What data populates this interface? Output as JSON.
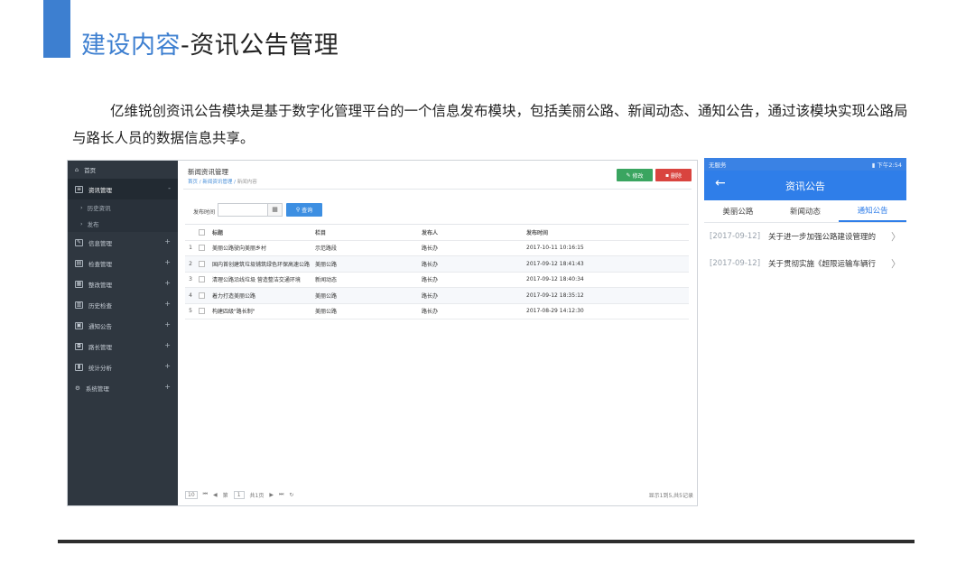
{
  "slide": {
    "title_accent": "建设内容",
    "title_rest": "-资讯公告管理",
    "description": "亿维锐创资讯公告模块是基于数字化管理平台的一个信息发布模块，包括美丽公路、新闻动态、通知公告，通过该模块实现公路局与路长人员的数据信息共享。"
  },
  "admin": {
    "sidebar": {
      "home": "首页",
      "items": [
        {
          "label": "资讯管理",
          "toggle": "-"
        },
        {
          "label": "信息管理",
          "toggle": "+"
        },
        {
          "label": "检查管理",
          "toggle": "+"
        },
        {
          "label": "整改管理",
          "toggle": "+"
        },
        {
          "label": "历史检查",
          "toggle": "+"
        },
        {
          "label": "通知公告",
          "toggle": "+"
        },
        {
          "label": "路长管理",
          "toggle": "+"
        },
        {
          "label": "统计分析",
          "toggle": "+"
        },
        {
          "label": "系统管理",
          "toggle": "+"
        }
      ],
      "subitems": [
        "历史资讯",
        "发布"
      ]
    },
    "page_title": "新闻资讯管理",
    "breadcrumb": {
      "home": "首页",
      "parent": "新闻资讯管理",
      "current": "新闻内容"
    },
    "edit_label": "修改",
    "delete_label": "删除",
    "search_label": "发布时间",
    "query_label": "查询",
    "table": {
      "headers": [
        "标题",
        "栏目",
        "发布人",
        "发布时间"
      ],
      "rows": [
        {
          "n": "1",
          "title": "美丽公路驶向美丽乡村",
          "column": "示范路段",
          "author": "路长办",
          "time": "2017-10-11 10:16:15"
        },
        {
          "n": "2",
          "title": "国内首创建筑垃圾铺筑绿色环保高速公路",
          "column": "美丽公路",
          "author": "路长办",
          "time": "2017-09-12 18:41:43"
        },
        {
          "n": "3",
          "title": "清理公路沿线垃圾 营造整洁交通环境",
          "column": "新闻动态",
          "author": "路长办",
          "time": "2017-09-12 18:40:34"
        },
        {
          "n": "4",
          "title": "着力打造美丽公路",
          "column": "美丽公路",
          "author": "路长办",
          "time": "2017-09-12 18:35:12"
        },
        {
          "n": "5",
          "title": "构建四级\"路长制\"",
          "column": "美丽公路",
          "author": "路长办",
          "time": "2017-08-29 14:12:30"
        }
      ]
    },
    "pager": {
      "page_size": "10",
      "page_prefix": "第",
      "page_current": "1",
      "page_suffix": "共1页",
      "info": "显示1到5,共5记录"
    }
  },
  "mobile": {
    "status_left": "无服务",
    "status_right": "下午2:54",
    "nav_title": "资讯公告",
    "tabs": [
      "美丽公路",
      "新闻动态",
      "通知公告"
    ],
    "active_tab": "通知公告",
    "notices": [
      {
        "date": "[2017-09-12]",
        "text": "关于进一步加强公路建设管理的"
      },
      {
        "date": "[2017-09-12]",
        "text": "关于贯彻实施《超限运输车辆行"
      }
    ]
  }
}
